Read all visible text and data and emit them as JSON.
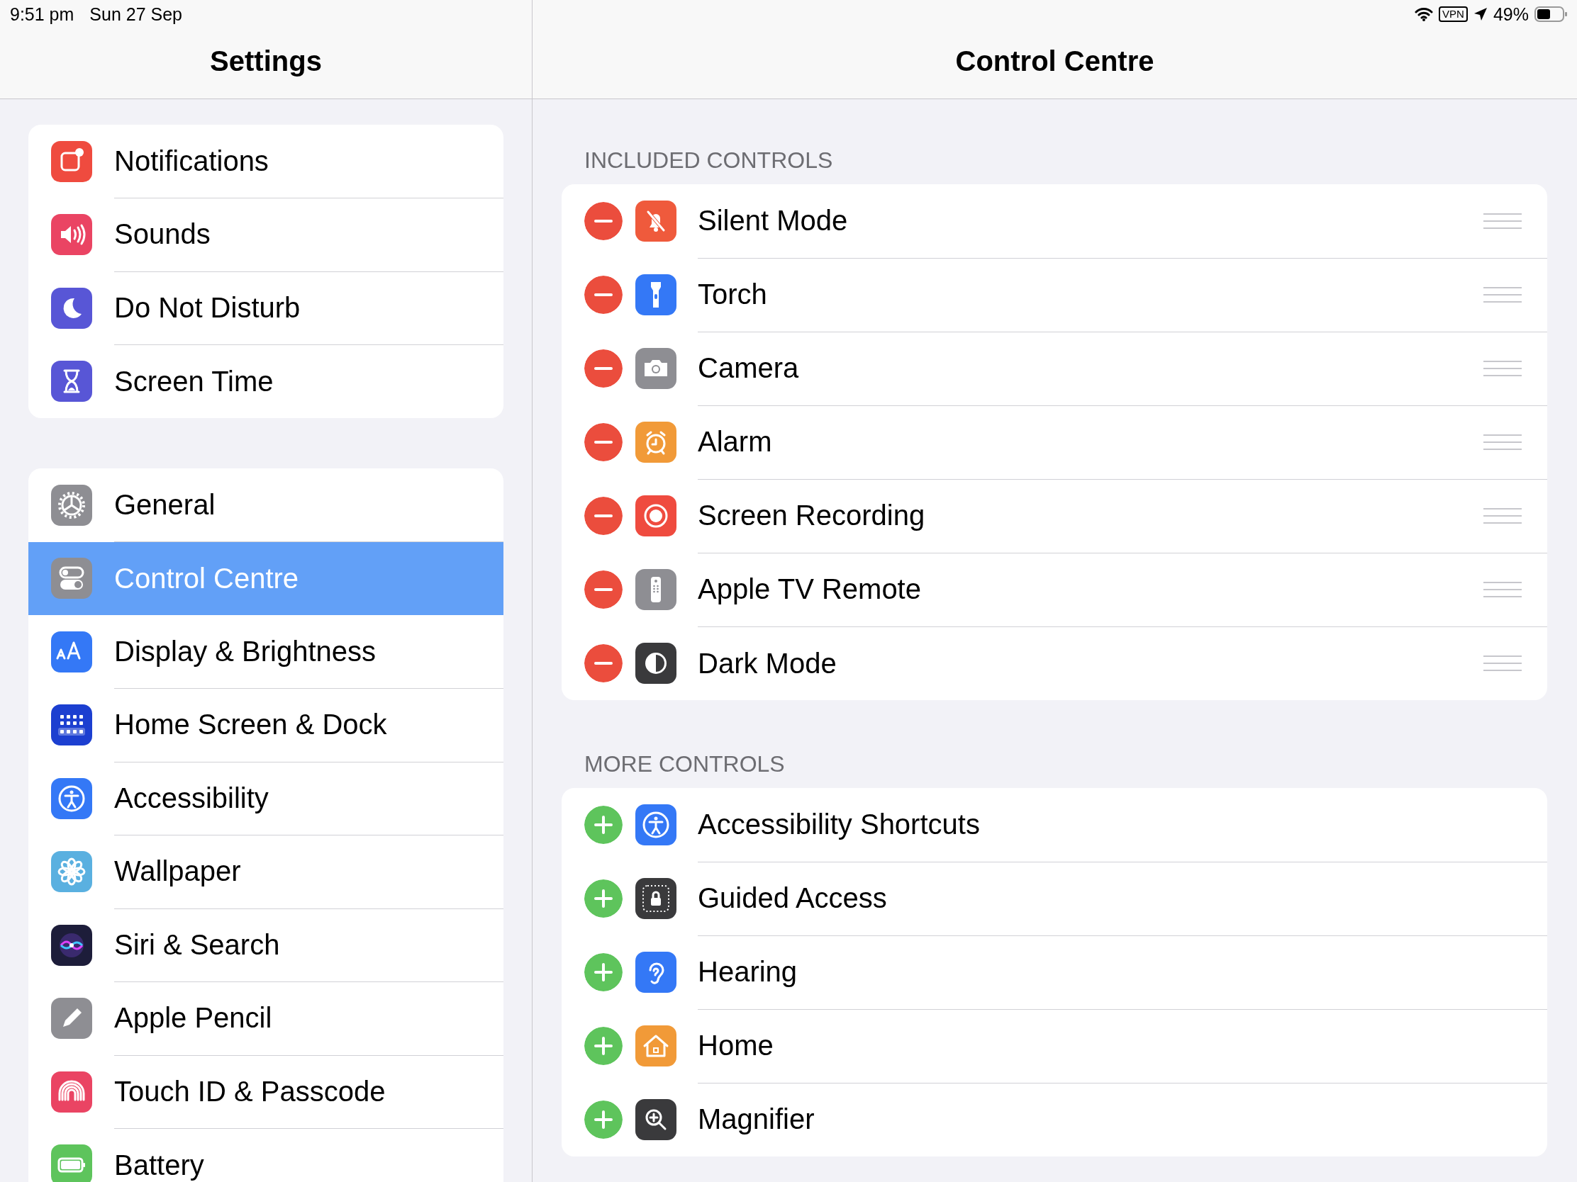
{
  "status_bar": {
    "time": "9:51 pm",
    "date": "Sun 27 Sep",
    "vpn": "VPN",
    "battery": "49%"
  },
  "sidebar": {
    "title": "Settings",
    "groups": [
      {
        "items": [
          {
            "label": "Notifications",
            "selected": false
          },
          {
            "label": "Sounds",
            "selected": false
          },
          {
            "label": "Do Not Disturb",
            "selected": false
          },
          {
            "label": "Screen Time",
            "selected": false
          }
        ]
      },
      {
        "items": [
          {
            "label": "General",
            "selected": false
          },
          {
            "label": "Control Centre",
            "selected": true
          },
          {
            "label": "Display & Brightness",
            "selected": false
          },
          {
            "label": "Home Screen & Dock",
            "selected": false
          },
          {
            "label": "Accessibility",
            "selected": false
          },
          {
            "label": "Wallpaper",
            "selected": false
          },
          {
            "label": "Siri & Search",
            "selected": false
          },
          {
            "label": "Apple Pencil",
            "selected": false
          },
          {
            "label": "Touch ID & Passcode",
            "selected": false
          },
          {
            "label": "Battery",
            "selected": false
          }
        ]
      }
    ]
  },
  "detail": {
    "title": "Control Centre",
    "sections": [
      {
        "header": "INCLUDED CONTROLS",
        "items": [
          {
            "label": "Silent Mode",
            "kind": "remove"
          },
          {
            "label": "Torch",
            "kind": "remove"
          },
          {
            "label": "Camera",
            "kind": "remove"
          },
          {
            "label": "Alarm",
            "kind": "remove"
          },
          {
            "label": "Screen Recording",
            "kind": "remove"
          },
          {
            "label": "Apple TV Remote",
            "kind": "remove"
          },
          {
            "label": "Dark Mode",
            "kind": "remove"
          }
        ]
      },
      {
        "header": "MORE CONTROLS",
        "items": [
          {
            "label": "Accessibility Shortcuts",
            "kind": "add"
          },
          {
            "label": "Guided Access",
            "kind": "add"
          },
          {
            "label": "Hearing",
            "kind": "add"
          },
          {
            "label": "Home",
            "kind": "add"
          },
          {
            "label": "Magnifier",
            "kind": "add"
          }
        ]
      }
    ]
  }
}
